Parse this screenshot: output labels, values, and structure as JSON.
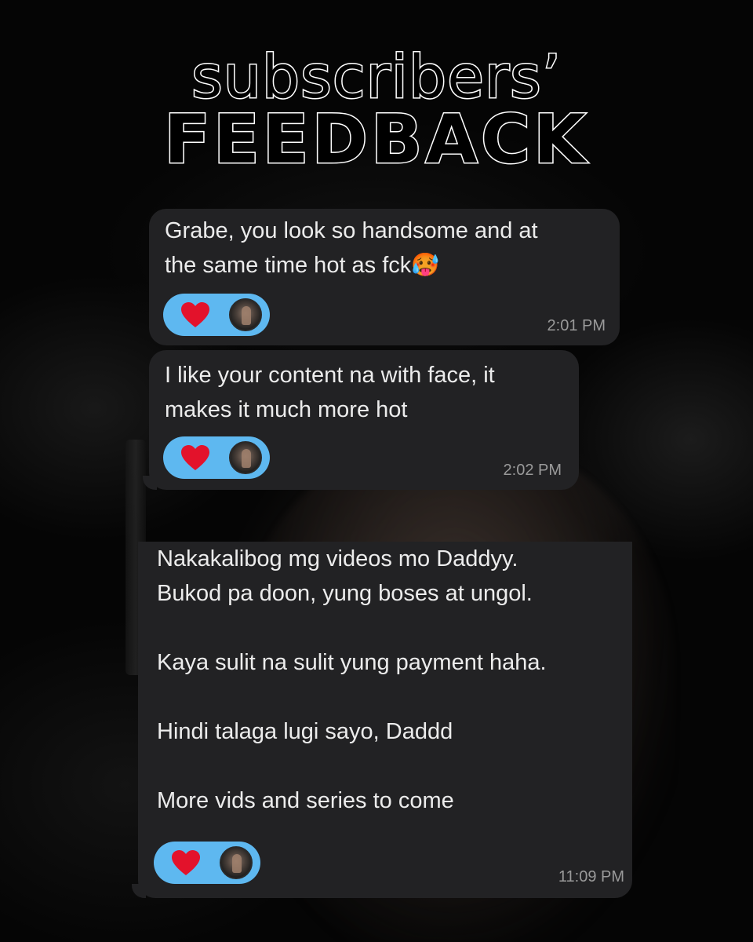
{
  "header": {
    "line1": "subscribers’",
    "line2": "FEEDBACK"
  },
  "messages": [
    {
      "text": "Grabe, you look so handsome and at\nthe same time hot as fck🥵",
      "reaction": "heart",
      "time": "2:01 PM"
    },
    {
      "text": "I like your content na with face, it\nmakes it much more hot",
      "reaction": "heart",
      "time": "2:02 PM"
    },
    {
      "text": "Nakakalibog mg videos mo Daddyy.\nBukod pa doon, yung boses at ungol.\n\nKaya sulit na sulit yung payment haha.\n\nHindi talaga lugi sayo, Daddd\n\nMore vids and series to come",
      "reaction": "heart",
      "time": "11:09 PM"
    }
  ],
  "colors": {
    "bubble": "#222224",
    "reaction_pill": "#5eb8f0",
    "heart": "#e3122b",
    "timestamp": "#9a9a9a"
  }
}
